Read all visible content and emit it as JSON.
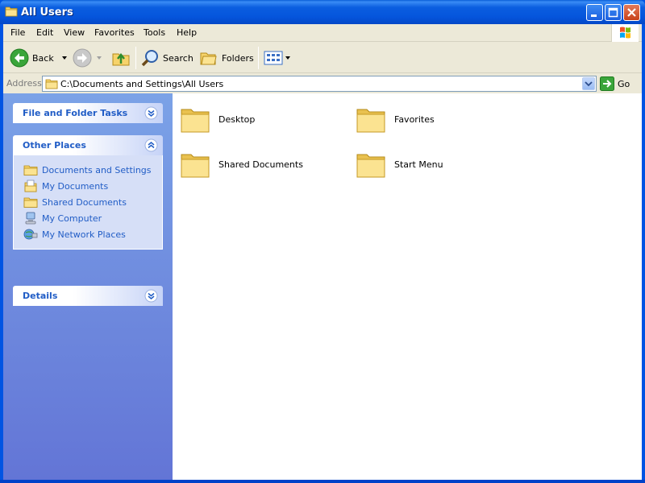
{
  "window": {
    "title": "All Users",
    "buttons": {
      "minimize": "minimize",
      "maximize": "maximize",
      "close": "close"
    }
  },
  "menubar": {
    "items": [
      "File",
      "Edit",
      "View",
      "Favorites",
      "Tools",
      "Help"
    ]
  },
  "toolbar": {
    "back_label": "Back",
    "search_label": "Search",
    "folders_label": "Folders"
  },
  "address": {
    "label": "Address",
    "value": "C:\\Documents and Settings\\All Users",
    "go_label": "Go"
  },
  "sidebar": {
    "file_tasks": {
      "title": "File and Folder Tasks",
      "state": "collapsed"
    },
    "other_places": {
      "title": "Other Places",
      "state": "expanded",
      "items": [
        {
          "label": "Documents and Settings",
          "icon": "folder-icon"
        },
        {
          "label": "My Documents",
          "icon": "my-documents-icon"
        },
        {
          "label": "Shared Documents",
          "icon": "folder-icon"
        },
        {
          "label": "My Computer",
          "icon": "my-computer-icon"
        },
        {
          "label": "My Network Places",
          "icon": "network-places-icon"
        }
      ]
    },
    "details": {
      "title": "Details",
      "state": "collapsed"
    }
  },
  "content": {
    "items": [
      {
        "label": "Desktop",
        "icon": "folder-icon"
      },
      {
        "label": "Favorites",
        "icon": "folder-icon"
      },
      {
        "label": "Shared Documents",
        "icon": "folder-icon"
      },
      {
        "label": "Start Menu",
        "icon": "folder-icon"
      }
    ]
  },
  "colors": {
    "title_blue": "#0054e3",
    "sidebar_link": "#215dc6",
    "sidebar_bg_top": "#7ba2e7",
    "sidebar_bg_bottom": "#6375d6",
    "folder_yellow": "#f6d36b",
    "chrome": "#ece9d8"
  }
}
